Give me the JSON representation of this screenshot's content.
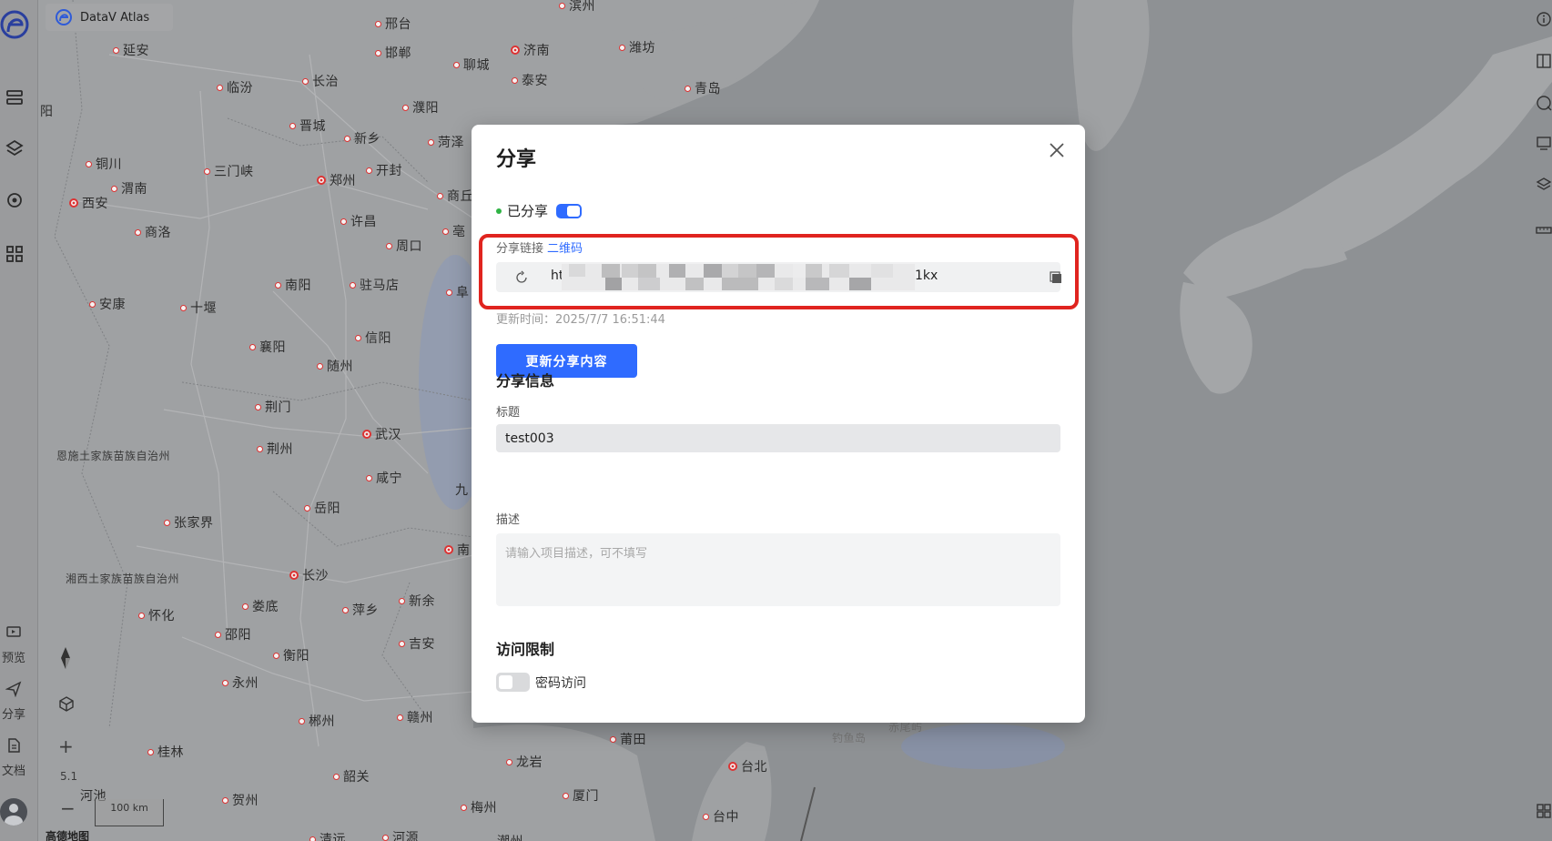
{
  "app": {
    "brand": "DataV Atlas"
  },
  "rail": {
    "preview": "预览",
    "share": "分享",
    "docs": "文档"
  },
  "map": {
    "zoom": "5.1",
    "scale": "100 km",
    "attribution": "高德地图",
    "cities": [
      {
        "name": "滨州"
      },
      {
        "name": "邢台"
      },
      {
        "name": "延安"
      },
      {
        "name": "邯郸"
      },
      {
        "name": "济南"
      },
      {
        "name": "潍坊"
      },
      {
        "name": "聊城"
      },
      {
        "name": "泰安"
      },
      {
        "name": "临汾"
      },
      {
        "name": "长治"
      },
      {
        "name": "青岛"
      },
      {
        "name": "濮阳"
      },
      {
        "name": "晋城"
      },
      {
        "name": "新乡"
      },
      {
        "name": "菏泽"
      },
      {
        "name": "铜川"
      },
      {
        "name": "三门峡"
      },
      {
        "name": "开封"
      },
      {
        "name": "渭南"
      },
      {
        "name": "郑州"
      },
      {
        "name": "商丘"
      },
      {
        "name": "西安"
      },
      {
        "name": "许昌"
      },
      {
        "name": "商洛"
      },
      {
        "name": "周口"
      },
      {
        "name": "安康"
      },
      {
        "name": "十堰"
      },
      {
        "name": "南阳"
      },
      {
        "name": "驻马店"
      },
      {
        "name": "信阳"
      },
      {
        "name": "襄阳"
      },
      {
        "name": "随州"
      },
      {
        "name": "荆门"
      },
      {
        "name": "武汉"
      },
      {
        "name": "荆州"
      },
      {
        "name": "恩施土家族苗族自治州"
      },
      {
        "name": "咸宁"
      },
      {
        "name": "岳阳"
      },
      {
        "name": "张家界"
      },
      {
        "name": "长沙"
      },
      {
        "name": "湘西土家族苗族自治州"
      },
      {
        "name": "娄底"
      },
      {
        "name": "萍乡"
      },
      {
        "name": "新余"
      },
      {
        "name": "怀化"
      },
      {
        "name": "邵阳"
      },
      {
        "name": "吉安"
      },
      {
        "name": "衡阳"
      },
      {
        "name": "永州"
      },
      {
        "name": "郴州"
      },
      {
        "name": "赣州"
      },
      {
        "name": "莆田"
      },
      {
        "name": "桂林"
      },
      {
        "name": "韶关"
      },
      {
        "name": "龙岩"
      },
      {
        "name": "台北"
      },
      {
        "name": "贺州"
      },
      {
        "name": "梅州"
      },
      {
        "name": "厦门"
      },
      {
        "name": "台中"
      },
      {
        "name": "钓鱼岛"
      },
      {
        "name": "赤尾屿"
      },
      {
        "name": "阜"
      },
      {
        "name": "亳"
      },
      {
        "name": "南"
      },
      {
        "name": "九"
      },
      {
        "name": "阳"
      },
      {
        "name": "河池"
      },
      {
        "name": "清远"
      },
      {
        "name": "河源"
      },
      {
        "name": "潮州"
      }
    ]
  },
  "modal": {
    "title": "分享",
    "shared_label": "已分享",
    "link_label": "分享链接",
    "qr_label": "二维码",
    "link_prefix": "ht",
    "link_suffix": "1kx",
    "update_time": "更新时间：2025/7/7 16:51:44",
    "update_button": "更新分享内容",
    "info_section": "分享信息",
    "title_label": "标题",
    "title_value": "test003",
    "desc_label": "描述",
    "desc_placeholder": "请输入项目描述，可不填写",
    "access_section": "访问限制",
    "password_label": "密码访问"
  },
  "colors": {
    "accent": "#2f6bff",
    "highlight": "#e0241f",
    "shared_dot": "#2fb344"
  }
}
